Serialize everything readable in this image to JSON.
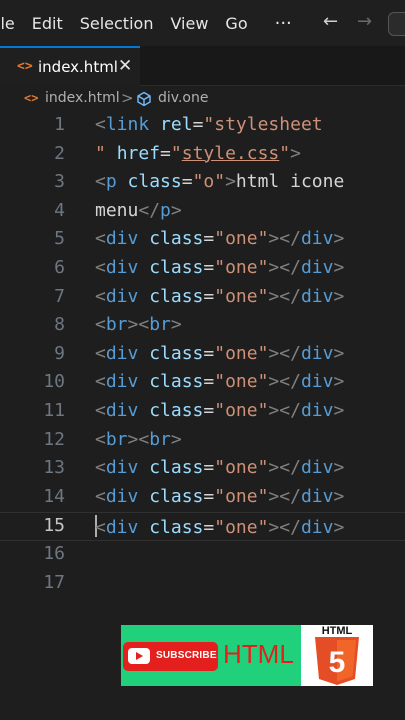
{
  "menubar": {
    "items": [
      "ile",
      "Edit",
      "Selection",
      "View",
      "Go"
    ],
    "more": "···",
    "back": "←",
    "forward": "→"
  },
  "tab": {
    "icon": "<>",
    "label": "index.html",
    "close": "✕"
  },
  "breadcrumb": {
    "file_icon": "<>",
    "file": "index.html",
    "separator": ">",
    "symbol": "div.one"
  },
  "editor": {
    "current_line": 15,
    "lines": [
      {
        "n": "1"
      },
      {
        "n": "2"
      },
      {
        "n": "3"
      },
      {
        "n": "4"
      },
      {
        "n": "5"
      },
      {
        "n": "6"
      },
      {
        "n": "7"
      },
      {
        "n": "8"
      },
      {
        "n": "9"
      },
      {
        "n": "10"
      },
      {
        "n": "11"
      },
      {
        "n": "12"
      },
      {
        "n": "13"
      },
      {
        "n": "14"
      },
      {
        "n": "15"
      },
      {
        "n": "16"
      },
      {
        "n": "17"
      }
    ],
    "tokens": {
      "lt": "<",
      "gt": ">",
      "close_lt": "</",
      "eq": "=",
      "link": "link",
      "rel": "rel",
      "q_stylesheet": "\"stylesheet",
      "q_open_space": "\" ",
      "href": "href",
      "q": "\"",
      "style_css": "style.css",
      "p": "p",
      "class": "class",
      "q_o": "\"o\"",
      "html_icone": "html icone",
      "menu": "menu",
      "div": "div",
      "q_one": "\"one\"",
      "br": "br",
      "space": " "
    }
  },
  "promo": {
    "subscribe": "SUBSCRIBE",
    "html_text": "HTML",
    "html5_title": "HTML",
    "html5_number": "5",
    "colors": {
      "background": "#21d07a",
      "red": "#e4201f",
      "html5_orange": "#e44d26"
    }
  }
}
